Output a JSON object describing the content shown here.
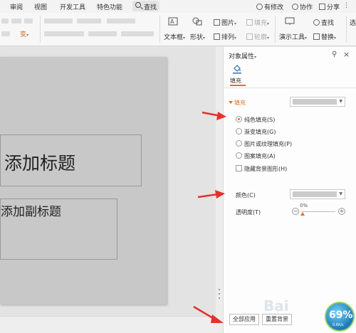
{
  "menubar": {
    "items": [
      "审阅",
      "视图",
      "开发工具",
      "特色功能"
    ],
    "search_label": "查找",
    "right": [
      "有修改",
      "协作",
      "分享"
    ]
  },
  "toolbar": {
    "textbox": "文本框",
    "shape": "形状",
    "arrange": "排列",
    "picture": "图片",
    "fill": "填充",
    "outline": "轮廓",
    "present_tools": "演示工具",
    "find": "查找",
    "replace": "替换"
  },
  "slide": {
    "title_placeholder": "添加标题",
    "subtitle_placeholder": "添加副标题"
  },
  "pane": {
    "title": "对象属性",
    "tab": "填充",
    "fill_heading": "填充",
    "options": [
      {
        "label": "纯色填充(S)",
        "type": "radio",
        "checked": true
      },
      {
        "label": "渐变填充(G)",
        "type": "radio",
        "checked": false
      },
      {
        "label": "图片或纹理填充(P)",
        "type": "radio",
        "checked": false
      },
      {
        "label": "图案填充(A)",
        "type": "radio",
        "checked": false
      },
      {
        "label": "隐藏背景图形(H)",
        "type": "checkbox",
        "checked": false
      }
    ],
    "color_label": "颜色(C)",
    "transparency_label": "透明度(T)",
    "transparency_value": "0%",
    "apply_all": "全部应用",
    "reset_background": "重置背景",
    "swatch_color": "#cbcbcb",
    "accent_color": "#e0721f"
  },
  "watermark": {
    "text": "Bai"
  },
  "speed_ball": {
    "percent": "69%",
    "net": "0.6K/s"
  }
}
